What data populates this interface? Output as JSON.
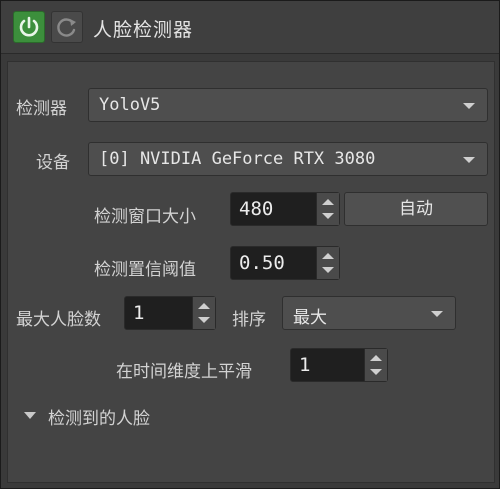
{
  "header": {
    "title": "人脸检测器",
    "power_icon": "power-icon",
    "reset_icon": "refresh-icon",
    "power_color": "#3c8f3c"
  },
  "detector": {
    "label": "检测器",
    "value": "YoloV5"
  },
  "device": {
    "label": "设备",
    "value": "[0] NVIDIA GeForce RTX 3080"
  },
  "window_size": {
    "label": "检测窗口大小",
    "value": "480",
    "auto_label": "自动"
  },
  "threshold": {
    "label": "检测置信阈值",
    "value": "0.50"
  },
  "max_faces": {
    "label": "最大人脸数",
    "value": "1"
  },
  "sort": {
    "label": "排序",
    "value": "最大"
  },
  "smoothing": {
    "label": "在时间维度上平滑",
    "value": "1"
  },
  "detected_section": {
    "label": "检测到的人脸"
  }
}
